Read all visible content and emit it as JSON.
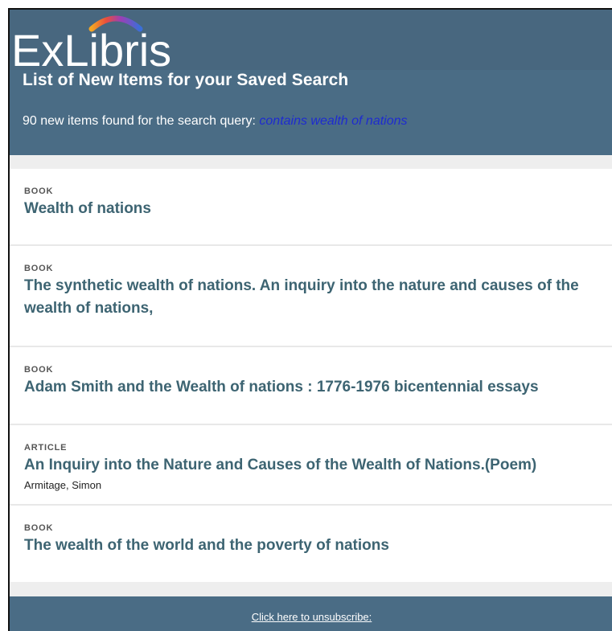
{
  "header": {
    "logo_text": "ExLibris",
    "title": "List of New Items for your Saved Search",
    "summary_prefix": "90 new items found for the search query: ",
    "query": "contains wealth of nations"
  },
  "items": [
    {
      "type": "BOOK",
      "title": "Wealth of nations",
      "author": ""
    },
    {
      "type": "BOOK",
      "title": "The synthetic wealth of nations. An inquiry into the nature and causes of the wealth of nations,",
      "author": ""
    },
    {
      "type": "BOOK",
      "title": "Adam Smith and the Wealth of nations : 1776-1976 bicentennial essays",
      "author": ""
    },
    {
      "type": "ARTICLE",
      "title": "An Inquiry into the Nature and Causes of the Wealth of Nations.(Poem)",
      "author": "Armitage, Simon"
    },
    {
      "type": "BOOK",
      "title": "The wealth of the world and the poverty of nations",
      "author": ""
    }
  ],
  "footer": {
    "unsubscribe_label": "Click here to unsubscribe:"
  },
  "colors": {
    "header_bg": "#4a6c85",
    "title_color": "#3d6472",
    "query_link": "#1e2bd0"
  }
}
